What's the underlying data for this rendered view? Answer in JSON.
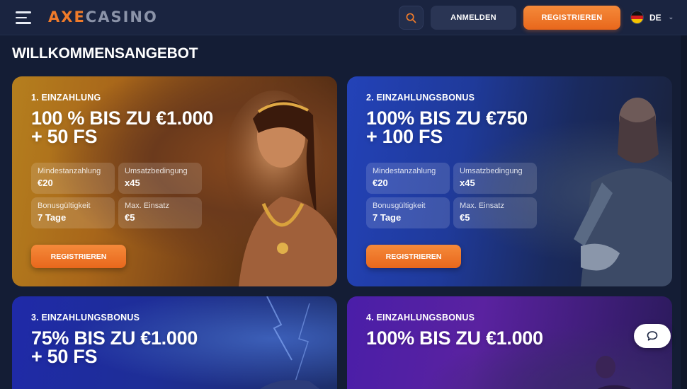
{
  "header": {
    "logo_axe": "AXE",
    "logo_casino": "CASINO",
    "login_label": "ANMELDEN",
    "register_label": "REGISTRIEREN",
    "language": "DE",
    "icons": [
      "menu-icon",
      "search-icon",
      "flag-de-icon",
      "chevron-down-icon"
    ]
  },
  "page": {
    "title": "WILLKOMMENSANGEBOT"
  },
  "colors": {
    "accent": "#f07b2a",
    "background": "#141d35",
    "header": "#1a2440"
  },
  "offers": [
    {
      "label": "1. EINZAHLUNG",
      "title_line1": "100 % BIS ZU €1.000",
      "title_line2": "+ 50 FS",
      "stats": [
        {
          "key": "Mindestanzahlung",
          "value": "€20"
        },
        {
          "key": "Umsatzbedingung",
          "value": "x45"
        },
        {
          "key": "Bonusgültigkeit",
          "value": "7 Tage"
        },
        {
          "key": "Max. Einsatz",
          "value": "€5"
        }
      ],
      "button": "REGISTRIEREN"
    },
    {
      "label": "2. EINZAHLUNGSBONUS",
      "title_line1": "100% BIS ZU €750",
      "title_line2": "+ 100 FS",
      "stats": [
        {
          "key": "Mindestanzahlung",
          "value": "€20"
        },
        {
          "key": "Umsatzbedingung",
          "value": "x45"
        },
        {
          "key": "Bonusgültigkeit",
          "value": "7 Tage"
        },
        {
          "key": "Max. Einsatz",
          "value": "€5"
        }
      ],
      "button": "REGISTRIEREN"
    },
    {
      "label": "3. EINZAHLUNGSBONUS",
      "title_line1": "75% BIS ZU €1.000",
      "title_line2": "+ 50 FS"
    },
    {
      "label": "4. EINZAHLUNGSBONUS",
      "title_line1": "100% BIS ZU €1.000",
      "title_line2": ""
    }
  ]
}
